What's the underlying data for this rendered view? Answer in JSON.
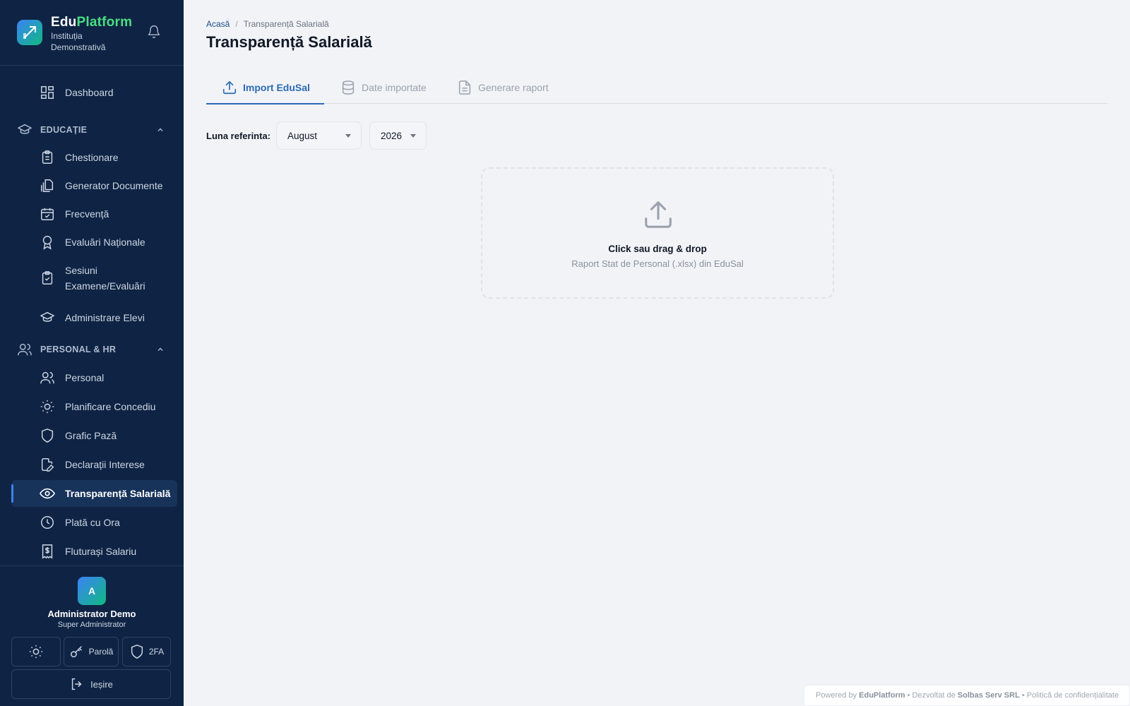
{
  "brand": {
    "name_part1": "Edu",
    "name_part2": "Platform",
    "institution": "Instituția Demonstrativă"
  },
  "sidebar": {
    "dashboard": "Dashboard",
    "sections": [
      {
        "title": "EDUCAȚIE",
        "icon": "graduation-cap-icon"
      },
      {
        "title": "PERSONAL & HR",
        "icon": "users-icon"
      }
    ],
    "education_items": [
      {
        "label": "Chestionare",
        "icon": "clipboard-list-icon"
      },
      {
        "label": "Generator Documente",
        "icon": "documents-icon"
      },
      {
        "label": "Frecvență",
        "icon": "calendar-check-icon"
      },
      {
        "label": "Evaluări Naționale",
        "icon": "award-icon"
      },
      {
        "label": "Sesiuni Examene/Evaluări",
        "icon": "clipboard-check-icon"
      },
      {
        "label": "Administrare Elevi",
        "icon": "graduation-cap-icon"
      }
    ],
    "hr_items": [
      {
        "label": "Personal",
        "icon": "users-icon"
      },
      {
        "label": "Planificare Concediu",
        "icon": "sun-icon"
      },
      {
        "label": "Grafic Pază",
        "icon": "shield-icon"
      },
      {
        "label": "Declarații Interese",
        "icon": "file-edit-icon"
      },
      {
        "label": "Transparență Salarială",
        "icon": "eye-icon",
        "active": true
      },
      {
        "label": "Plată cu Ora",
        "icon": "clock-icon"
      },
      {
        "label": "Fluturași Salariu",
        "icon": "receipt-dollar-icon"
      }
    ]
  },
  "user": {
    "initial": "A",
    "name": "Administrator Demo",
    "role": "Super Administrator"
  },
  "actions": {
    "password": "Parolă",
    "twofa": "2FA",
    "logout": "Ieșire"
  },
  "breadcrumb": {
    "home": "Acasă",
    "current": "Transparență Salarială"
  },
  "page": {
    "title": "Transparență Salarială"
  },
  "tabs": [
    {
      "label": "Import EduSal",
      "icon": "upload-icon",
      "active": true
    },
    {
      "label": "Date importate",
      "icon": "database-icon",
      "active": false
    },
    {
      "label": "Generare raport",
      "icon": "file-text-icon",
      "active": false
    }
  ],
  "filters": {
    "month_label": "Luna referinta:",
    "month": "August",
    "year": "2026"
  },
  "dropzone": {
    "title": "Click sau drag & drop",
    "subtitle": "Raport Stat de Personal (.xlsx) din EduSal"
  },
  "footer": {
    "powered_by": "Powered by",
    "brand": "EduPlatform",
    "bullet": "•",
    "developed_by": "Dezvoltat de",
    "company": "Solbas Serv SRL",
    "privacy": "Politică de confidențialitate"
  },
  "colors": {
    "sidebar_bg": "#0f2444",
    "accent": "#2a6bb4",
    "brand_green": "#4ade80",
    "page_bg": "#f1f3f7"
  }
}
